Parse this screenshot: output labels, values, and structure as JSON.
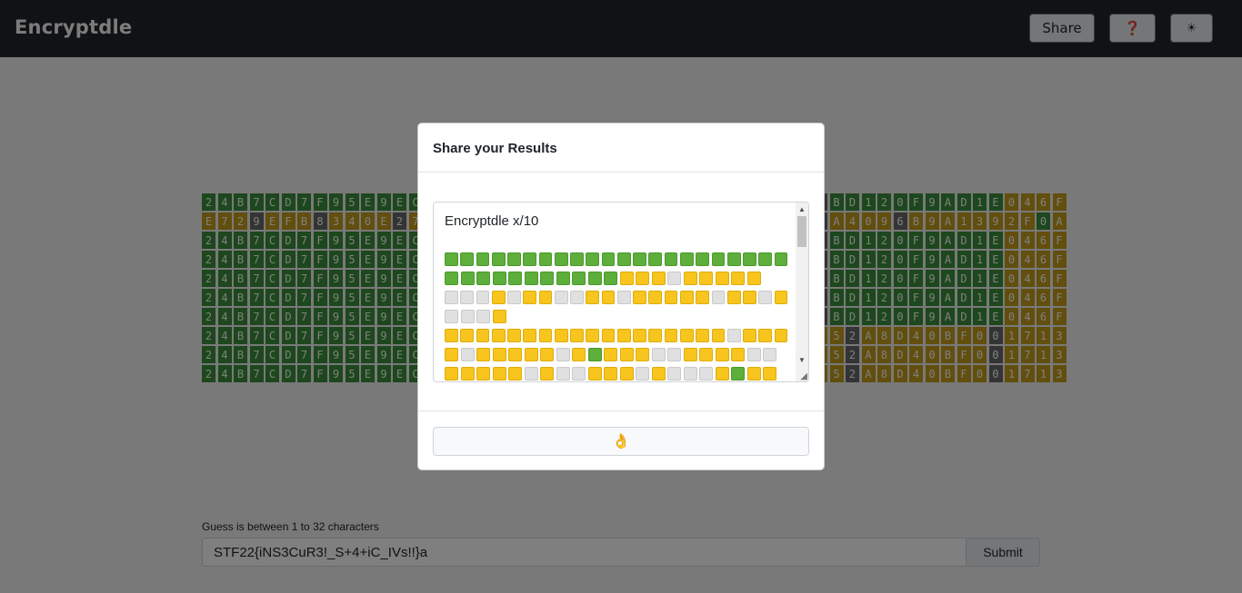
{
  "navbar": {
    "brand": "Encryptdle",
    "share_label": "Share",
    "help_icon": "question-icon",
    "theme_icon": "sun-icon",
    "help_label": "❓",
    "theme_label": "☀"
  },
  "colors": {
    "correct": "#3a8f3a",
    "present": "#c59d1b",
    "absent": "#686868"
  },
  "board": {
    "rows": [
      {
        "chars": "24B7CD7F95E9EC4E",
        "right": "1BD120F9AD1E046F"
      },
      {
        "chars": "E729EFB8340E2756",
        "right": "1A4096B9A1392F0A"
      },
      {
        "chars": "24B7CD7F95E9EC4E",
        "right": "1BD120F9AD1E046F"
      },
      {
        "chars": "24B7CD7F95E9EC4E",
        "right": "1BD120F9AD1E046F"
      },
      {
        "chars": "24B7CD7F95E9EC4E",
        "right": "1BD120F9AD1E046F"
      },
      {
        "chars": "24B7CD7F95E9EC4E",
        "right": "1BD120F9AD1E046F"
      },
      {
        "chars": "24B7CD7F95E9EC4E",
        "right": "1BD120F9AD1E046F"
      },
      {
        "chars": "24B7CD7F95E9EC4E",
        "right": "E52A8D40BF001713"
      },
      {
        "chars": "24B7CD7F95E9EC4E",
        "right": "E52A8D40BF001713"
      },
      {
        "chars": "24B7CD7F95E9EC4E",
        "right": "E52A8D40BF001713"
      }
    ],
    "row_states": [
      "gggggggggggggggg|xgggggggggggyyyy",
      "yyyxyyyxyyyyxyyy|xyyyyxyyyyyyyygy",
      "gggggggggggggggg|xgggggggggggyyyy",
      "gggggggggggggggg|xgggggggggggyyyy",
      "gggggggggggggggg|xgggggggggggyyyy",
      "gggggggggggggggg|xgggggggggggyyyy",
      "gggggggggggggggg|xgggggggggggyyyy",
      "gggggggggggggggg|yyxyyyyyyyyxyyyy",
      "gggggggggggggggg|yyxyyyyyyyyxyyyy",
      "gggggggggggggggg|yyxyyyyyyyyxyyyy"
    ]
  },
  "guess": {
    "label": "Guess is between 1 to 32 characters",
    "value": "STF22{iNS3CuR3!_S+4+iC_IVs!!}a",
    "submit_label": "Submit"
  },
  "modal": {
    "title": "Share your Results",
    "share_text_title": "Encryptdle x/10",
    "square_lines": [
      "gggggggggggggggggggggg",
      "gggggggggggyyywyyyyy",
      "wwwywyywwyywyyyyywyywy",
      "wwwy",
      "yyyyyyyyyyyyyyyyyywyyy",
      "ywyyyyywygyyywwyyyyww",
      "yyyyywywwyyywywwwygyy"
    ],
    "copy_button_label": "👌",
    "copy_icon": "ok-hand-icon"
  }
}
